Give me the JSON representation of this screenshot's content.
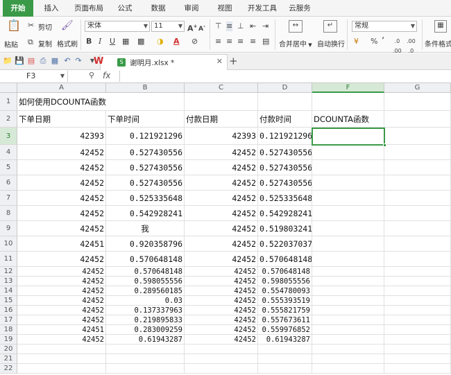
{
  "menu": {
    "tabs": [
      "开始",
      "插入",
      "页面布局",
      "公式",
      "数据",
      "审阅",
      "视图",
      "开发工具",
      "云服务"
    ],
    "active": 0
  },
  "ribbon": {
    "paste": "粘贴",
    "cut": "剪切",
    "copy": "复制",
    "format_painter": "格式刷",
    "font_name": "宋体",
    "font_size": "11",
    "merge_center": "合并居中",
    "wrap_text": "自动换行",
    "number_format": "常规",
    "cond_format": "条件格式"
  },
  "doc": {
    "filename": "谢明月.xlsx *"
  },
  "formula_bar": {
    "cell_ref": "F3",
    "fx": "fx",
    "content": ""
  },
  "sheet": {
    "columns": [
      "A",
      "B",
      "C",
      "D",
      "E",
      "F",
      "G"
    ],
    "selected_column": "F",
    "selected_row": 3,
    "rows": [
      {
        "n": "1",
        "a": "如何使用DCOUNTA函数",
        "b": "",
        "c": "",
        "d": "",
        "f": ""
      },
      {
        "n": "2",
        "a": "下单日期",
        "b": "下单时间",
        "c": "付款日期",
        "d": "付款时间",
        "f": "DCOUNTA函数"
      },
      {
        "n": "3",
        "a": "42393",
        "b": "0.121921296",
        "c": "42393",
        "d": "0.121921296",
        "f": ""
      },
      {
        "n": "4",
        "a": "42452",
        "b": "0.527430556",
        "c": "42452",
        "d": "0.527430556",
        "f": ""
      },
      {
        "n": "5",
        "a": "42452",
        "b": "0.527430556",
        "c": "42452",
        "d": "0.527430556",
        "f": ""
      },
      {
        "n": "6",
        "a": "42452",
        "b": "0.527430556",
        "c": "42452",
        "d": "0.527430556",
        "f": ""
      },
      {
        "n": "7",
        "a": "42452",
        "b": "0.525335648",
        "c": "42452",
        "d": "0.525335648",
        "f": ""
      },
      {
        "n": "8",
        "a": "42452",
        "b": "0.542928241",
        "c": "42452",
        "d": "0.542928241",
        "f": ""
      },
      {
        "n": "9",
        "a": "42452",
        "b": "我",
        "c": "42452",
        "d": "0.519803241",
        "f": ""
      },
      {
        "n": "10",
        "a": "42451",
        "b": "0.920358796",
        "c": "42452",
        "d": "0.522037037",
        "f": ""
      },
      {
        "n": "11",
        "a": "42452",
        "b": "0.570648148",
        "c": "42452",
        "d": "0.570648148",
        "f": ""
      },
      {
        "n": "12",
        "a": "42452",
        "b": "0.570648148",
        "c": "42452",
        "d": "0.570648148",
        "f": ""
      },
      {
        "n": "13",
        "a": "42452",
        "b": "0.598055556",
        "c": "42452",
        "d": "0.598055556",
        "f": ""
      },
      {
        "n": "14",
        "a": "42452",
        "b": "0.289560185",
        "c": "42452",
        "d": "0.554780093",
        "f": ""
      },
      {
        "n": "15",
        "a": "42452",
        "b": "0.03",
        "c": "42452",
        "d": "0.555393519",
        "f": ""
      },
      {
        "n": "16",
        "a": "42452",
        "b": "0.137337963",
        "c": "42452",
        "d": "0.555821759",
        "f": ""
      },
      {
        "n": "17",
        "a": "42452",
        "b": "0.219895833",
        "c": "42452",
        "d": "0.557673611",
        "f": ""
      },
      {
        "n": "18",
        "a": "42451",
        "b": "0.283009259",
        "c": "42452",
        "d": "0.559976852",
        "f": ""
      },
      {
        "n": "19",
        "a": "42452",
        "b": "0.61943287",
        "c": "42452",
        "d": "0.61943287",
        "f": ""
      },
      {
        "n": "20",
        "a": "",
        "b": "",
        "c": "",
        "d": "",
        "f": ""
      },
      {
        "n": "21",
        "a": "",
        "b": "",
        "c": "",
        "d": "",
        "f": ""
      },
      {
        "n": "22",
        "a": "",
        "b": "",
        "c": "",
        "d": "",
        "f": ""
      }
    ]
  },
  "colors": {
    "accent": "#3a9a48"
  }
}
